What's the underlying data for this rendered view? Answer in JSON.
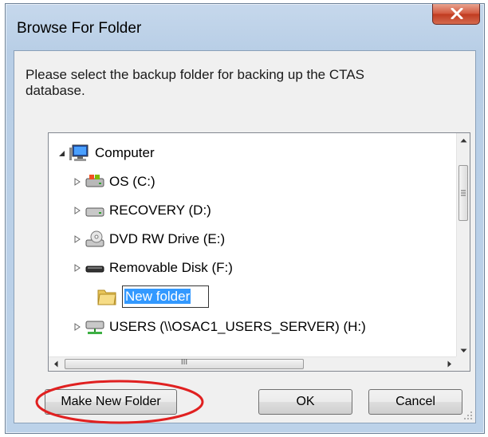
{
  "window": {
    "title": "Browse For Folder",
    "close_glyph": "x"
  },
  "instructions": "Please select the backup folder for backing up the CTAS database.",
  "tree": {
    "items": [
      {
        "label": "Computer",
        "icon": "computer-icon",
        "expander": "expanded"
      },
      {
        "label": "OS (C:)",
        "icon": "local-disk-icon",
        "expander": "collapsed"
      },
      {
        "label": "RECOVERY (D:)",
        "icon": "drive-icon",
        "expander": "collapsed"
      },
      {
        "label": "DVD RW Drive (E:)",
        "icon": "dvd-drive-icon",
        "expander": "collapsed"
      },
      {
        "label": "Removable Disk (F:)",
        "icon": "removable-disk-icon",
        "expander": "collapsed"
      },
      {
        "label": "New folder",
        "icon": "folder-icon",
        "expander": "none",
        "editing": true
      },
      {
        "label": "USERS (\\\\OSAC1_USERS_SERVER) (H:)",
        "icon": "network-drive-icon",
        "expander": "collapsed"
      }
    ],
    "hscroll_thumb_grip": "III"
  },
  "buttons": {
    "make_new_folder": "Make New Folder",
    "ok": "OK",
    "cancel": "Cancel"
  },
  "colors": {
    "annotation": "#e02020",
    "selection": "#3399ff"
  }
}
